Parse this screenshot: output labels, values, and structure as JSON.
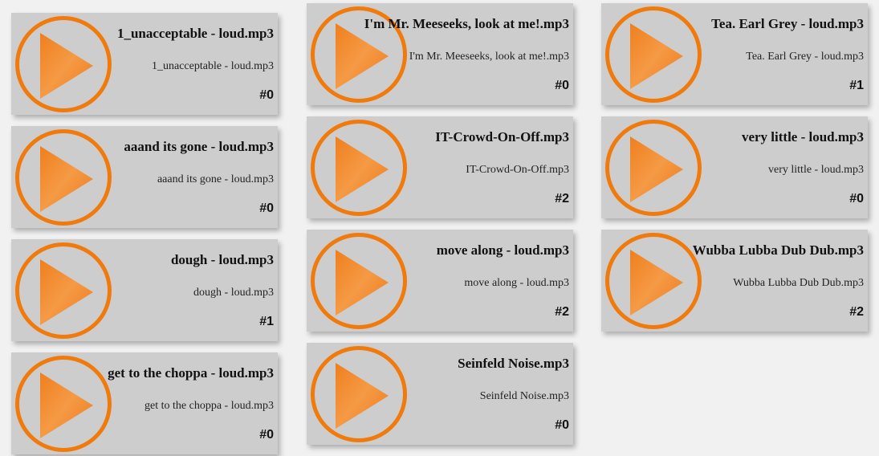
{
  "colors": {
    "accent": "#f07b0c",
    "card_bg": "#cdcdcd",
    "page_bg": "#f1f1f1"
  },
  "icons": {
    "play": "play-icon"
  },
  "columns": [
    {
      "sounds": [
        {
          "title": "1_unacceptable - loud.mp3",
          "filename": "1_unacceptable - loud.mp3",
          "count": "#0"
        },
        {
          "title": "aaand its gone - loud.mp3",
          "filename": "aaand its gone - loud.mp3",
          "count": "#0"
        },
        {
          "title": "dough - loud.mp3",
          "filename": "dough - loud.mp3",
          "count": "#1"
        },
        {
          "title": "get to the choppa - loud.mp3",
          "filename": "get to the choppa - loud.mp3",
          "count": "#0"
        }
      ]
    },
    {
      "sounds": [
        {
          "title": "I'm Mr. Meeseeks, look at me!.mp3",
          "filename": "I'm Mr. Meeseeks, look at me!.mp3",
          "count": "#0"
        },
        {
          "title": "IT-Crowd-On-Off.mp3",
          "filename": "IT-Crowd-On-Off.mp3",
          "count": "#2"
        },
        {
          "title": "move along - loud.mp3",
          "filename": "move along - loud.mp3",
          "count": "#2"
        },
        {
          "title": "Seinfeld Noise.mp3",
          "filename": "Seinfeld Noise.mp3",
          "count": "#0"
        }
      ]
    },
    {
      "sounds": [
        {
          "title": "Tea. Earl Grey - loud.mp3",
          "filename": "Tea. Earl Grey - loud.mp3",
          "count": "#1"
        },
        {
          "title": "very little - loud.mp3",
          "filename": "very little - loud.mp3",
          "count": "#0"
        },
        {
          "title": "Wubba Lubba Dub Dub.mp3",
          "filename": "Wubba Lubba Dub Dub.mp3",
          "count": "#2"
        }
      ]
    }
  ]
}
